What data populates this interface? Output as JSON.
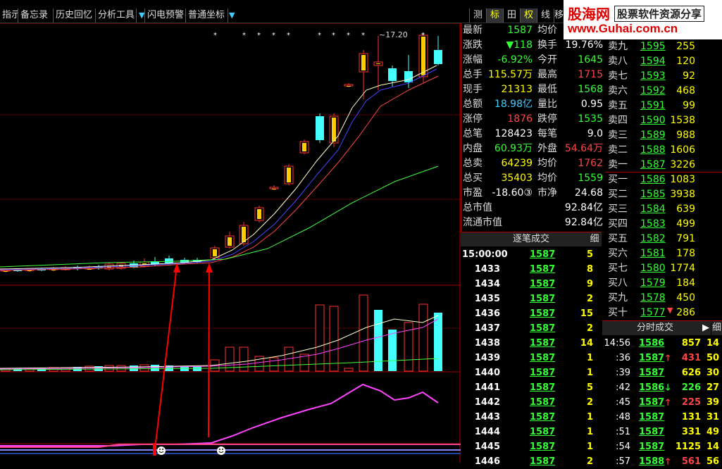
{
  "toolbar": {
    "items": [
      "指示",
      "备忘录",
      "历史回忆",
      "分析工具",
      "闪电预警",
      "普通坐标"
    ],
    "right_items": [
      "测",
      "标",
      "田",
      "权",
      "线",
      "移"
    ]
  },
  "logo": {
    "line1": "股海网",
    "line1b": "股票软件资源分享",
    "line2": "www.Guhai.com.cn"
  },
  "chart": {
    "peak_label": "~17.20",
    "ma_colors": {
      "ma5": "#ffffcc",
      "ma10": "#4444ff",
      "ma20": "#ff4444",
      "ma60": "#44ff44"
    },
    "up_color": "#ffcc00",
    "down_color": "#44ffff"
  },
  "quote": {
    "rows": [
      {
        "l": "最新",
        "v": "1587",
        "vc": "green",
        "l2": "均价",
        "v2": "",
        "v2c": "white"
      },
      {
        "l": "涨跌",
        "v": "▼118",
        "vc": "green",
        "l2": "换手",
        "v2": "19.76%",
        "v2c": "white"
      },
      {
        "l": "涨幅",
        "v": "-6.92%",
        "vc": "green",
        "l2": "今开",
        "v2": "1645",
        "v2c": "green"
      },
      {
        "l": "总手",
        "v": "115.57万",
        "vc": "yellow",
        "l2": "最高",
        "v2": "1715",
        "v2c": "red"
      },
      {
        "l": "现手",
        "v": "21313",
        "vc": "yellow",
        "l2": "最低",
        "v2": "1568",
        "v2c": "green"
      },
      {
        "l": "总额",
        "v": "18.98亿",
        "vc": "cyan",
        "l2": "量比",
        "v2": "0.95",
        "v2c": "white"
      },
      {
        "l": "涨停",
        "v": "1876",
        "vc": "red",
        "l2": "跌停",
        "v2": "1535",
        "v2c": "green"
      },
      {
        "l": "总笔",
        "v": "128423",
        "vc": "white",
        "l2": "每笔",
        "v2": "9.0",
        "v2c": "white"
      },
      {
        "l": "内盘",
        "v": "60.93万",
        "vc": "green",
        "l2": "外盘",
        "v2": "54.64万",
        "v2c": "red"
      },
      {
        "l": "总卖",
        "v": "64239",
        "vc": "yellow",
        "l2": "均价",
        "v2": "1762",
        "v2c": "red"
      },
      {
        "l": "总买",
        "v": "35403",
        "vc": "yellow",
        "l2": "均价",
        "v2": "1559",
        "v2c": "green"
      },
      {
        "l": "市盈",
        "v": "-18.60③",
        "vc": "white",
        "l2": "市净",
        "v2": "24.68",
        "v2c": "white"
      },
      {
        "l": "总市值",
        "v": "",
        "vc": "white",
        "l2": "",
        "v2": "92.84亿",
        "v2c": "white"
      },
      {
        "l": "流通市值",
        "v": "",
        "vc": "white",
        "l2": "",
        "v2": "92.84亿",
        "v2c": "white"
      }
    ]
  },
  "orderbook": {
    "rows": [
      {
        "l": "卖九",
        "p": "1595",
        "v": "255"
      },
      {
        "l": "卖八",
        "p": "1594",
        "v": "120"
      },
      {
        "l": "卖七",
        "p": "1593",
        "v": "92"
      },
      {
        "l": "卖六",
        "p": "1592",
        "v": "468"
      },
      {
        "l": "卖五",
        "p": "1591",
        "v": "99"
      },
      {
        "l": "卖四",
        "p": "1590",
        "v": "1538"
      },
      {
        "l": "卖三",
        "p": "1589",
        "v": "988"
      },
      {
        "l": "卖二",
        "p": "1588",
        "v": "1606"
      },
      {
        "l": "卖一",
        "p": "1587",
        "v": "3226"
      },
      {
        "l": "买一",
        "p": "1586",
        "v": "1083"
      },
      {
        "l": "买二",
        "p": "1585",
        "v": "3938"
      },
      {
        "l": "买三",
        "p": "1584",
        "v": "639"
      },
      {
        "l": "买四",
        "p": "1583",
        "v": "499"
      },
      {
        "l": "买五",
        "p": "1582",
        "v": "791"
      },
      {
        "l": "买六",
        "p": "1581",
        "v": "178"
      },
      {
        "l": "买七",
        "p": "1580",
        "v": "1774"
      },
      {
        "l": "买八",
        "p": "1579",
        "v": "184"
      },
      {
        "l": "买九",
        "p": "1578",
        "v": "450"
      },
      {
        "l": "买十",
        "p": "1577",
        "v": "286"
      }
    ]
  },
  "trades": {
    "header": "逐笔成交",
    "detail": "细",
    "rows": [
      {
        "t": "15:00:00",
        "p": "1587",
        "v": "5"
      },
      {
        "t": "1433",
        "p": "1587",
        "v": "8"
      },
      {
        "t": "1434",
        "p": "1587",
        "v": "9"
      },
      {
        "t": "1435",
        "p": "1587",
        "v": "2"
      },
      {
        "t": "1436",
        "p": "1587",
        "v": "15"
      },
      {
        "t": "1437",
        "p": "1587",
        "v": "2"
      },
      {
        "t": "1438",
        "p": "1587",
        "v": "14"
      },
      {
        "t": "1439",
        "p": "1587",
        "v": "1"
      },
      {
        "t": "1440",
        "p": "1587",
        "v": "1"
      },
      {
        "t": "1441",
        "p": "1587",
        "v": "5"
      },
      {
        "t": "1442",
        "p": "1587",
        "v": "2"
      },
      {
        "t": "1443",
        "p": "1587",
        "v": "1"
      },
      {
        "t": "1444",
        "p": "1587",
        "v": "1"
      },
      {
        "t": "1445",
        "p": "1587",
        "v": "1"
      },
      {
        "t": "1446",
        "p": "1587",
        "v": "2"
      }
    ]
  },
  "ticks": {
    "header": "分时成交",
    "detail": "细",
    "rows": [
      {
        "t": "14:56",
        "p": "1586",
        "a": "",
        "v": "857",
        "x": "14"
      },
      {
        "t": ":36",
        "p": "1587",
        "a": "up",
        "v": "431",
        "x": "50"
      },
      {
        "t": ":39",
        "p": "1587",
        "a": "",
        "v": "626",
        "x": "30"
      },
      {
        "t": ":42",
        "p": "1586",
        "a": "down",
        "v": "226",
        "x": "27"
      },
      {
        "t": ":45",
        "p": "1587",
        "a": "up",
        "v": "225",
        "x": "39"
      },
      {
        "t": ":48",
        "p": "1587",
        "a": "",
        "v": "131",
        "x": "31"
      },
      {
        "t": ":51",
        "p": "1587",
        "a": "",
        "v": "331",
        "x": "49"
      },
      {
        "t": ":54",
        "p": "1587",
        "a": "",
        "v": "1125",
        "x": "14"
      },
      {
        "t": ":57",
        "p": "1588",
        "a": "up",
        "v": "561",
        "x": "56"
      }
    ]
  }
}
